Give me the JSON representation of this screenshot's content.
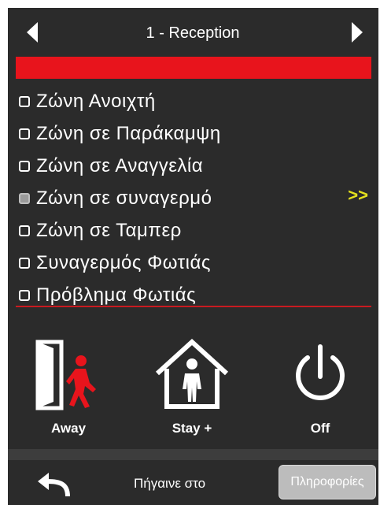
{
  "header": {
    "title": "1 - Reception",
    "prev_icon": "triangle-left-icon",
    "next_icon": "triangle-right-icon"
  },
  "colors": {
    "background": "#2b2b2b",
    "alarm_red": "#e8141c",
    "accent_yellow": "#e6e21e",
    "button_gray": "#bcbcbc"
  },
  "status_items": [
    {
      "label": "Ζώνη Ανοιχτή",
      "checked": false
    },
    {
      "label": "Ζώνη σε Παράκαμψη",
      "checked": false
    },
    {
      "label": "Ζώνη σε Αναγγελία",
      "checked": false
    },
    {
      "label": "Ζώνη σε συναγερμό",
      "checked": true
    },
    {
      "label": "Ζώνη σε Ταμπερ",
      "checked": false
    },
    {
      "label": "Συναγερμός Φωτιάς",
      "checked": false
    },
    {
      "label": "Πρόβλημα Φωτιάς",
      "checked": false
    }
  ],
  "more_link": ">>",
  "modes": {
    "away": {
      "label": "Away",
      "icon": "door-exit-person-icon"
    },
    "stay": {
      "label": "Stay +",
      "icon": "house-person-icon"
    },
    "off": {
      "label": "Off",
      "icon": "power-icon"
    }
  },
  "footer": {
    "back_icon": "back-arrow-icon",
    "goto_label": "Πήγαινε στο",
    "info_label": "Πληροφορίες"
  }
}
